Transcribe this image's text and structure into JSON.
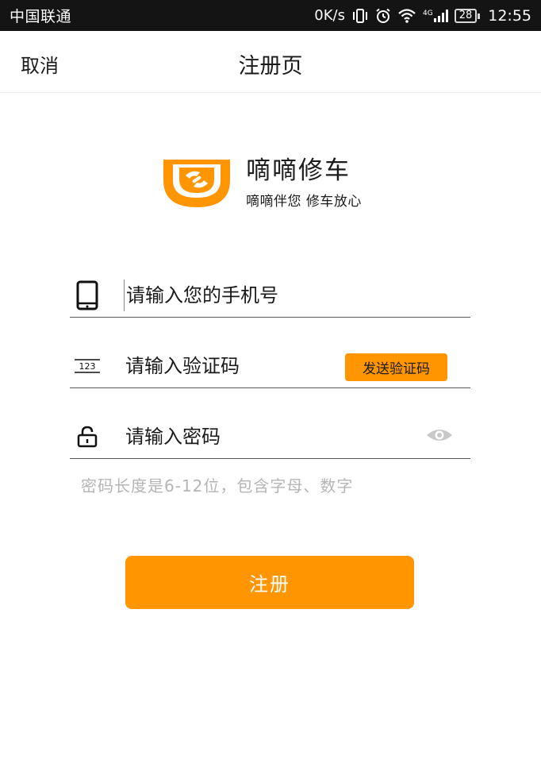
{
  "status_bar": {
    "carrier": "中国联通",
    "speed": "0K/s",
    "network": "4G",
    "battery": "28",
    "time": "12:55"
  },
  "nav": {
    "cancel_label": "取消",
    "title": "注册页"
  },
  "logo": {
    "title": "嘀嘀修车",
    "slogan": "嘀嘀伴您 修车放心",
    "icon": "wrench-shield-logo",
    "brand_color": "#ff9500"
  },
  "form": {
    "phone": {
      "icon": "phone-icon",
      "placeholder": "请输入您的手机号",
      "value": ""
    },
    "code": {
      "icon": "number-123-icon",
      "placeholder": "请输入验证码",
      "value": "",
      "send_label": "发送验证码"
    },
    "password": {
      "icon": "lock-icon",
      "placeholder": "请输入密码",
      "value": "",
      "toggle_icon": "eye-icon"
    },
    "hint": "密码长度是6-12位，包含字母、数字"
  },
  "register": {
    "label": "注册"
  },
  "colors": {
    "accent": "#ff9500",
    "status_bar": "#141414",
    "hint_text": "#b5b5b5"
  }
}
